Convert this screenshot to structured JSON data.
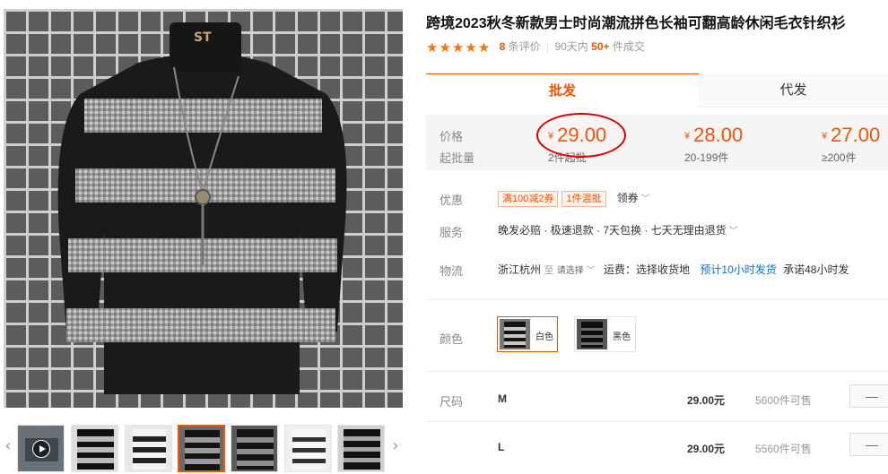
{
  "product": {
    "title": "跨境2023秋冬新款男士时尚潮流拼色长袖可翻高龄休闲毛衣针织衫",
    "image_logo_text": "ST"
  },
  "rating": {
    "stars": "★★★★★",
    "review_count": "8",
    "review_suffix": "条评价",
    "sold_prefix": "90天内",
    "sold_count": "50+",
    "sold_suffix": "件成交"
  },
  "tabs": [
    {
      "label": "批发",
      "active": true
    },
    {
      "label": "代发",
      "active": false
    }
  ],
  "price_box": {
    "price_label": "价格",
    "moq_label": "起批量",
    "currency": "¥",
    "tiers": [
      {
        "price": "29.00",
        "qty": "2件起批"
      },
      {
        "price": "28.00",
        "qty": "20-199件"
      },
      {
        "price": "27.00",
        "qty": "≥200件"
      }
    ]
  },
  "promo": {
    "label": "优惠",
    "coupons": [
      "满100减2券",
      "1件混批"
    ],
    "get_coupon": "领券"
  },
  "service": {
    "label": "服务",
    "text": "晚发必赔 · 极速退款 · 7天包换 · 七天无理由退货"
  },
  "logistics": {
    "label": "物流",
    "origin": "浙江杭州",
    "to": "至",
    "select_placeholder": "请选择",
    "freight": "运费：选择收货地",
    "eta": "预计10小时发货",
    "promise": "承诺48小时发"
  },
  "color": {
    "label": "颜色",
    "options": [
      {
        "name": "白色",
        "selected": true
      },
      {
        "name": "黑色",
        "selected": false
      }
    ]
  },
  "size": {
    "label": "尺码",
    "rows": [
      {
        "name": "M",
        "price": "29.00元",
        "stock": "5600件可售",
        "stepper": "—"
      },
      {
        "name": "L",
        "price": "29.00元",
        "stock": "5560件可售",
        "stepper": "—"
      }
    ]
  },
  "gallery": {
    "prev": "‹",
    "next": "›"
  },
  "colors": {
    "accent": "#ff5000",
    "annotation": "#e00000",
    "link": "#0b6fd2"
  }
}
